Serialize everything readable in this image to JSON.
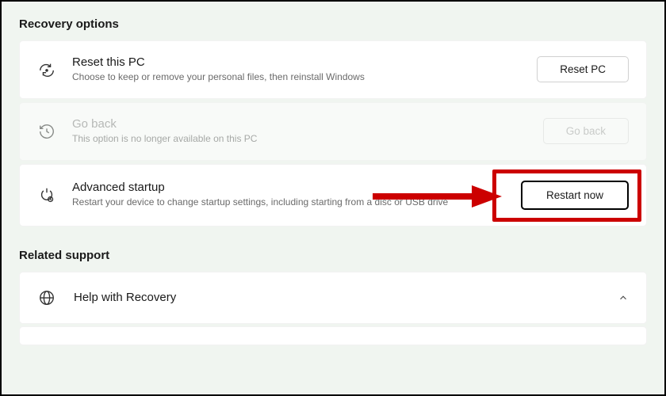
{
  "recovery": {
    "section_title": "Recovery options",
    "reset": {
      "title": "Reset this PC",
      "desc": "Choose to keep or remove your personal files, then reinstall Windows",
      "button": "Reset PC"
    },
    "goback": {
      "title": "Go back",
      "desc": "This option is no longer available on this PC",
      "button": "Go back"
    },
    "advanced": {
      "title": "Advanced startup",
      "desc": "Restart your device to change startup settings, including starting from a disc or USB drive",
      "button": "Restart now"
    }
  },
  "related": {
    "section_title": "Related support",
    "help": {
      "title": "Help with Recovery"
    },
    "partial": {
      "title": ""
    }
  }
}
